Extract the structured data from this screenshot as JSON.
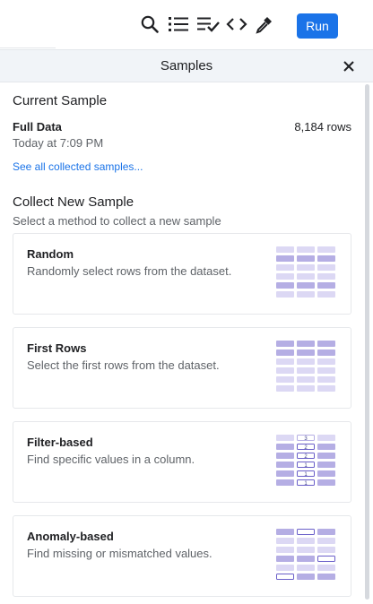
{
  "toolbar": {
    "icons": [
      "search-icon",
      "list-icon",
      "checklist-icon",
      "code-icon",
      "eyedropper-icon"
    ],
    "run_label": "Run",
    "accent": "#1a73e8"
  },
  "panel": {
    "title": "Samples",
    "close_icon": "close-icon"
  },
  "current_sample": {
    "heading": "Current Sample",
    "name": "Full Data",
    "rows": "8,184 rows",
    "time": "Today at 7:09 PM",
    "link": "See all collected samples..."
  },
  "collect": {
    "heading": "Collect New Sample",
    "subtitle": "Select a method to collect a new sample",
    "methods": [
      {
        "title": "Random",
        "description": "Randomly select rows from the dataset.",
        "icon": "random-sample-icon"
      },
      {
        "title": "First Rows",
        "description": "Select the first rows from the dataset.",
        "icon": "first-rows-icon"
      },
      {
        "title": "Filter-based",
        "description": "Find specific values in a column.",
        "icon": "filter-based-icon",
        "cell_numbers": [
          "3",
          "2",
          "2",
          "1",
          "1",
          "1"
        ]
      },
      {
        "title": "Anomaly-based",
        "description": "Find missing or mismatched values.",
        "icon": "anomaly-based-icon"
      }
    ]
  },
  "colors": {
    "text": "#202124",
    "muted": "#5f6368",
    "link": "#1a73e8",
    "header_bg": "#f1f4f8",
    "cell_strong": "#b5aee4",
    "cell_light": "#dcd8f4",
    "cell_outline": "#6a5fc9"
  }
}
